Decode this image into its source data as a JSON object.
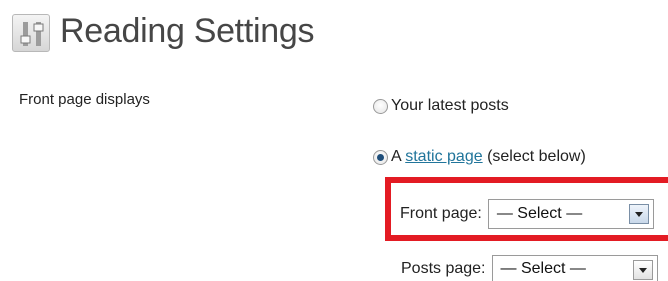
{
  "header": {
    "icon": "settings-sliders-icon",
    "title": "Reading Settings"
  },
  "front_page_displays": {
    "label": "Front page displays",
    "options": [
      {
        "text": "Your latest posts",
        "checked": false
      },
      {
        "prefix": "A ",
        "link_text": "static page",
        "suffix": " (select below)",
        "checked": true
      }
    ]
  },
  "front_page_select": {
    "label": "Front page:",
    "value": "— Select —"
  },
  "posts_page_select": {
    "label": "Posts page:",
    "value": "— Select —"
  },
  "colors": {
    "highlight": "#e31b23",
    "link": "#21759b"
  }
}
